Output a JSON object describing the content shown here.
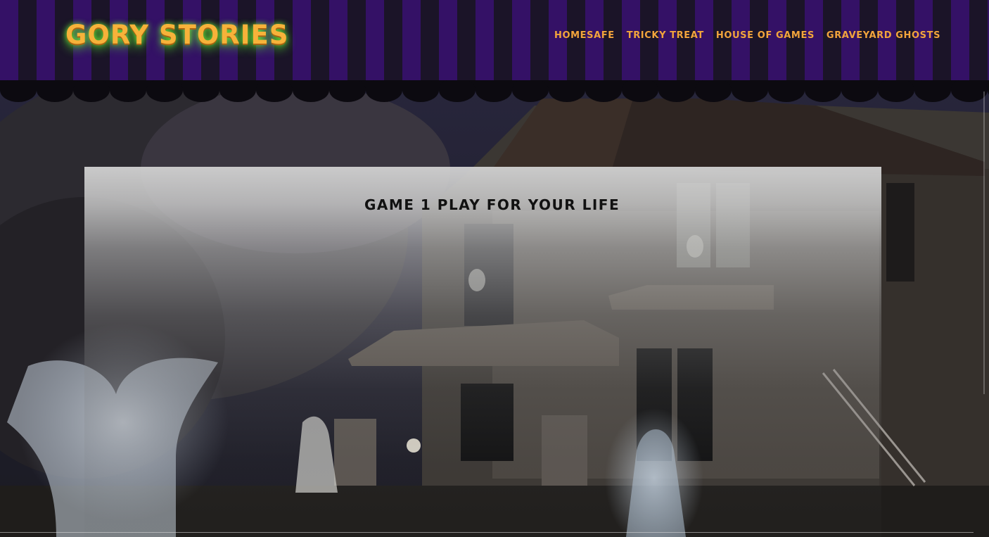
{
  "site": {
    "logo_text": "GORY STORIES"
  },
  "nav": {
    "items": [
      {
        "label": "HOMESAFE"
      },
      {
        "label": "TRICKY TREAT"
      },
      {
        "label": "HOUSE OF GAMES"
      },
      {
        "label": "GRAVEYARD GHOSTS"
      }
    ]
  },
  "main": {
    "title": "GAME 1 PLAY FOR YOUR LIFE"
  },
  "colors": {
    "stripe_purple": "#341166",
    "stripe_dark": "#1b1428",
    "logo_orange": "#f7b23a",
    "logo_glow": "#6ee83a",
    "nav_orange": "#f2a43c"
  },
  "icons": [
    "haunted-house-image",
    "ghost-figure",
    "skull"
  ]
}
